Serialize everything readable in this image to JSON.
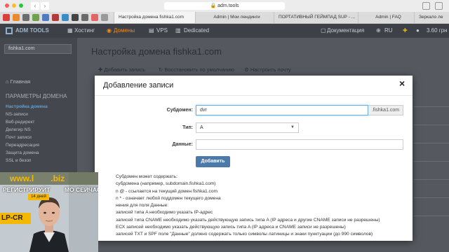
{
  "browser": {
    "address": "adm.tools",
    "tabs": [
      {
        "label": "Настройка домена fishka1.com",
        "active": true
      },
      {
        "label": "Admin | Мои лендинги",
        "active": false
      },
      {
        "label": "ПОРТАТИВНЫЙ ГЕЙМПАД SUP - ...",
        "active": false
      },
      {
        "label": "Admin | FAQ",
        "active": false
      },
      {
        "label": "Зеркало ле",
        "active": false
      }
    ]
  },
  "appnav": {
    "logo": "ADM TOOLS",
    "items": [
      "Хостинг",
      "Домены",
      "VPS",
      "Dedicated"
    ],
    "right": {
      "docs": "Документация",
      "lang": "RU",
      "balance": "3.60 грн"
    }
  },
  "sidebar": {
    "domain_select": "fishka1.com",
    "main_label": "Главная",
    "section_title": "ПАРАМЕТРЫ ДОМЕНА",
    "items": [
      "Настройка домена",
      "NS-записи",
      "Веб-редирект",
      "Делегир NS",
      "Почт записи",
      "Переадресация",
      "Защита домена",
      "SSL и безоп"
    ]
  },
  "page": {
    "title": "Настройка домена fishka1.com",
    "actions": [
      "Добавить запись",
      "Восстановить по умолчанию",
      "Настроить почту"
    ]
  },
  "modal": {
    "title": "Добавление записи",
    "close": "×",
    "subdomain_label": "Субдомен:",
    "subdomain_value": "dvr",
    "subdomain_suffix": ".fishka1.com",
    "type_label": "Тип:",
    "type_value": "A",
    "data_label": "Данные:",
    "data_value": "",
    "submit": "Добавить",
    "help": [
      "Субдомен может содержать:",
      "субдомена (например, subdomain.fishka1.com)",
      "n @ - ссылается на текущий домен fishka1.com",
      "n * - означает любой поддомен текущего домена",
      "нения для поля Данные:",
      "записей типа A необходимо указать IP-адрес",
      "записей типа CNAME необходимо указать действующую запись типа A (IP адреса и другие CNAME записи не разрешены)",
      "ЕСХ записей необходимо указать действующую запись типа A (IP адреса и CNAME записи не разрешены)",
      "записей TXT и SPF поле \"Данные\" должно содержать только символы латиницы и знаки пунктуации (до 990 символов)"
    ]
  },
  "video": {
    "site": "www.l",
    "site2": ".biz",
    "banner1": "РЕГИСТРИРУЙТ",
    "banner2": "МО СЕЙЧАС!",
    "days": "14 дней",
    "brand": "LP-CR"
  },
  "colors": {
    "accent": "#f08a1c",
    "button": "#4a79aa",
    "overlay": "#55595f"
  }
}
